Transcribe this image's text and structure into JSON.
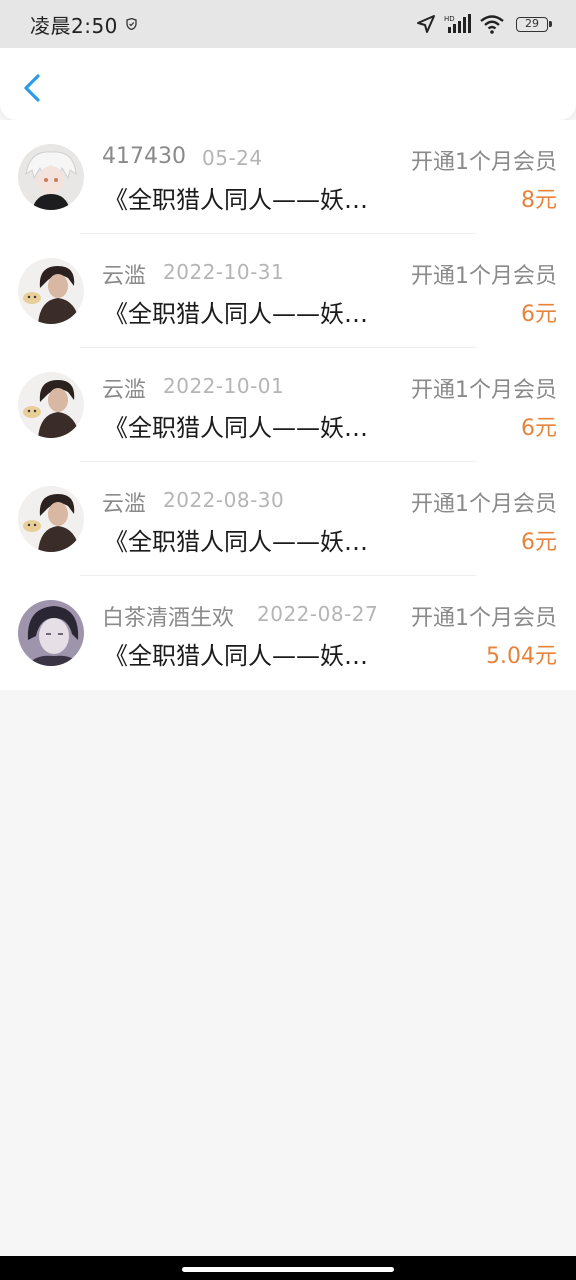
{
  "status_bar": {
    "time": "凌晨2:50",
    "battery": "29",
    "network_label": "HD"
  },
  "records": [
    {
      "name": "417430",
      "date": "05-24",
      "action": "开通1个月会员",
      "book": "《全职猎人同人——妖…",
      "amount": "8元",
      "avatar": "white-hair-avatar"
    },
    {
      "name": "云滥",
      "date": "2022-10-31",
      "action": "开通1个月会员",
      "book": "《全职猎人同人——妖…",
      "amount": "6元",
      "avatar": "dark-hair-avatar"
    },
    {
      "name": "云滥",
      "date": "2022-10-01",
      "action": "开通1个月会员",
      "book": "《全职猎人同人——妖…",
      "amount": "6元",
      "avatar": "dark-hair-avatar"
    },
    {
      "name": "云滥",
      "date": "2022-08-30",
      "action": "开通1个月会员",
      "book": "《全职猎人同人——妖…",
      "amount": "6元",
      "avatar": "dark-hair-avatar"
    },
    {
      "name": "白茶清酒生欢",
      "date": "2022-08-27",
      "action": "开通1个月会员",
      "book": "《全职猎人同人——妖…",
      "amount": "5.04元",
      "avatar": "purple-portrait-avatar"
    }
  ],
  "colors": {
    "accent": "#2d9be8",
    "amount": "#e6843e",
    "background": "#f7f6f7"
  }
}
